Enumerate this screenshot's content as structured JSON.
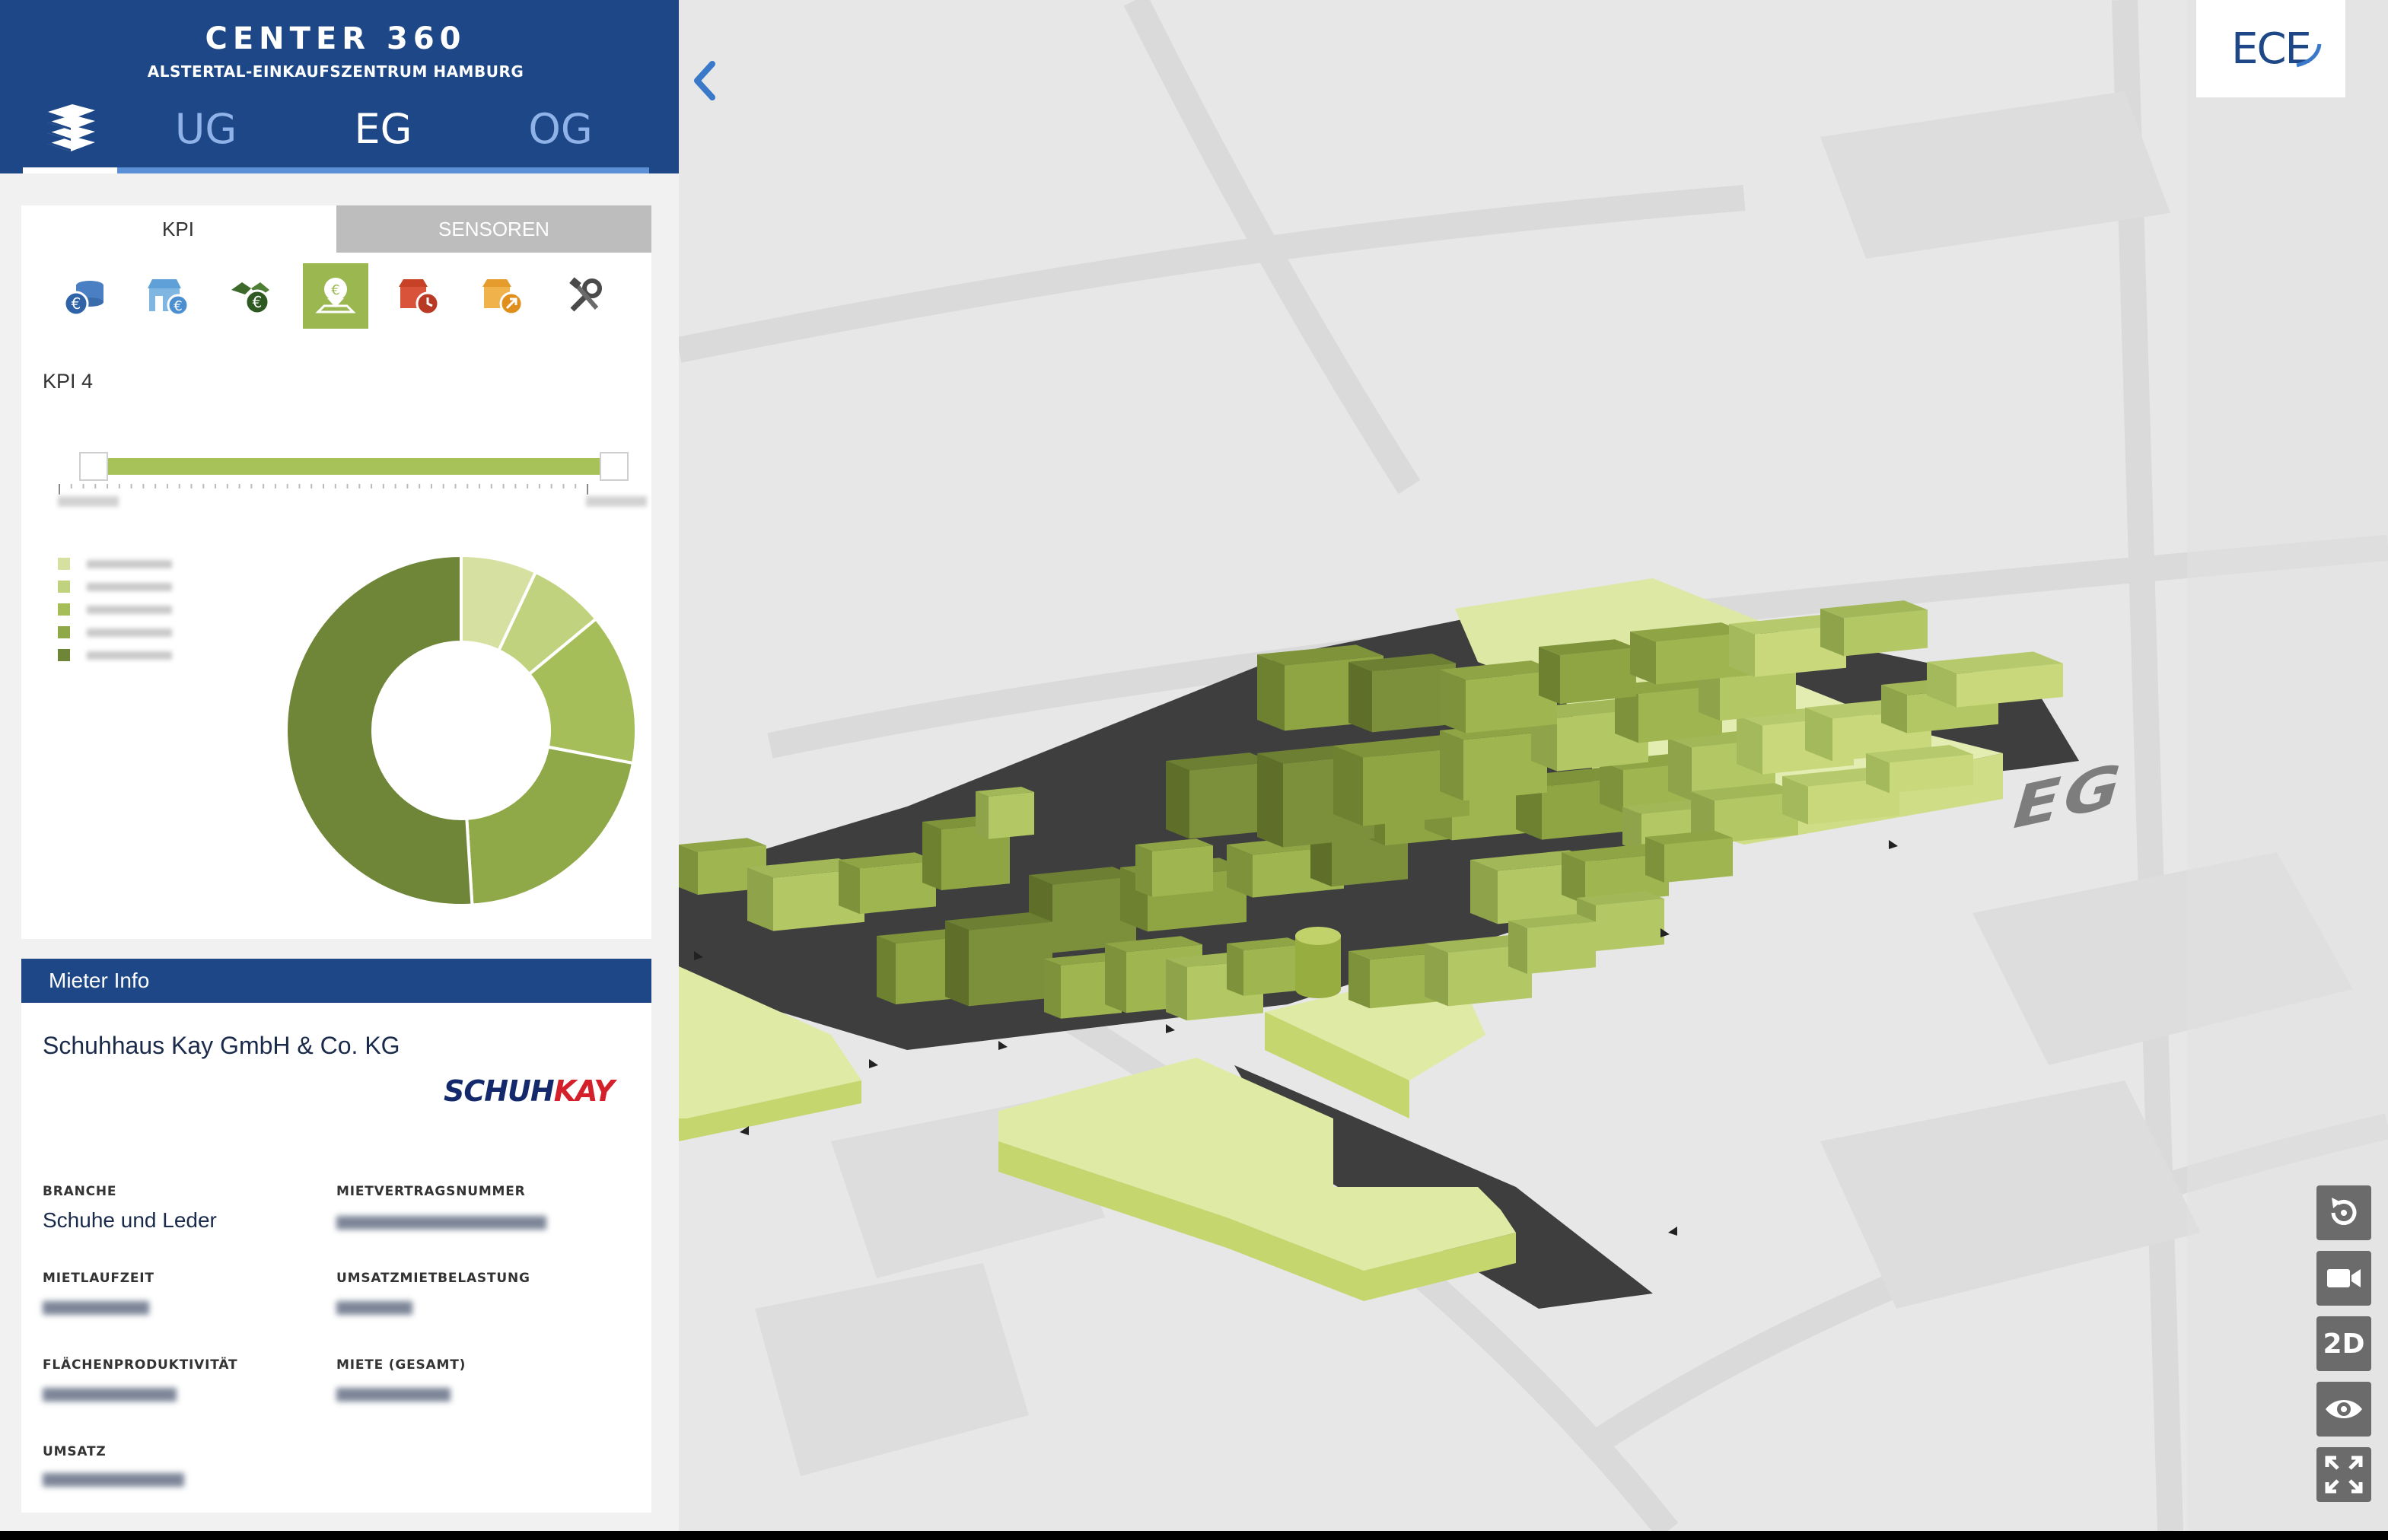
{
  "header": {
    "title": "CENTER 360",
    "subtitle": "ALSTERTAL-EINKAUFSZENTRUM HAMBURG",
    "floors": [
      "UG",
      "EG",
      "OG"
    ]
  },
  "kpi_panel": {
    "tabs": {
      "kpi": "KPI",
      "sensoren": "SENSOREN"
    },
    "icons": [
      "euro-coins-icon",
      "shop-euro-icon",
      "handshake-euro-icon",
      "map-pin-euro-icon",
      "store-clock-icon",
      "shop-arrow-icon",
      "tools-icon"
    ],
    "selected_icon_index": 3,
    "kpi_label": "KPI 4",
    "legend_colors": [
      "#d6e1a1",
      "#c1d27e",
      "#a6be59",
      "#8fa848",
      "#6f8537"
    ]
  },
  "chart_data": {
    "type": "pie",
    "subtype": "donut",
    "values": [
      7,
      7,
      14,
      21,
      51
    ],
    "colors": [
      "#d6e1a1",
      "#c1d27e",
      "#a6be59",
      "#8fa848",
      "#6f8537"
    ]
  },
  "tenant_info": {
    "header": "Mieter Info",
    "name": "Schuhhaus Kay GmbH & Co. KG",
    "logo_part1": "SCHUH",
    "logo_part2": "KAY",
    "fields": {
      "branche_label": "BRANCHE",
      "branche_value": "Schuhe und Leder",
      "mietvertragsnummer_label": "MIETVERTRAGSNUMMER",
      "mietlaufzeit_label": "MIETLAUFZEIT",
      "umsatzmietbelastung_label": "UMSATZMIETBELASTUNG",
      "flaechenproduktivitaet_label": "FLÄCHENPRODUKTIVITÄT",
      "miete_label": "MIETE (GESAMT)",
      "umsatz_label": "UMSATZ"
    }
  },
  "map": {
    "logo": "ECE",
    "floor_label": "EG",
    "controls": {
      "reset": "reset-view-icon",
      "camera": "video-camera-icon",
      "view_2d": "2D",
      "visibility": "eye-icon",
      "fullscreen": "fullscreen-icon"
    }
  }
}
